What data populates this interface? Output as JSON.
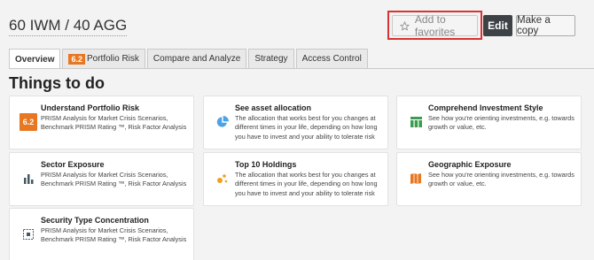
{
  "header": {
    "title": "60 IWM / 40 AGG",
    "favorites_label": "Add to favorites",
    "edit_label": "Edit",
    "copy_label": "Make a copy"
  },
  "tabs": [
    {
      "label": "Overview",
      "badge": ""
    },
    {
      "label": "Portfolio Risk",
      "badge": "6.2"
    },
    {
      "label": "Compare and Analyze",
      "badge": ""
    },
    {
      "label": "Strategy",
      "badge": ""
    },
    {
      "label": "Access Control",
      "badge": ""
    }
  ],
  "section_title": "Things to do",
  "cards": [
    {
      "title": "Understand Portfolio Risk",
      "desc": "PRISM Analysis for Market Crisis Scenarios, Benchmark PRISM Rating ™, Risk Factor Analysis",
      "icon": "prism-rating-badge-icon",
      "badge": "6.2"
    },
    {
      "title": "See asset allocation",
      "desc": "The allocation that works best for you changes at different times in your life, depending on how long you have to invest and your ability to tolerate risk",
      "icon": "pie-chart-icon"
    },
    {
      "title": "Comprehend Investment Style",
      "desc": "See how you're orienting investments, e.g. towards growth or value, etc.",
      "icon": "style-grid-icon"
    },
    {
      "title": "Sector Exposure",
      "desc": "PRISM Analysis for Market Crisis Scenarios, Benchmark PRISM Rating ™, Risk Factor Analysis",
      "icon": "bar-chart-icon"
    },
    {
      "title": "Top 10 Holdings",
      "desc": "The allocation that works best for you changes at different times in your life, depending on how long you have to invest and your ability to tolerate risk",
      "icon": "holdings-dots-icon"
    },
    {
      "title": "Geographic Exposure",
      "desc": "See how you're orienting investments, e.g. towards growth or value, etc.",
      "icon": "map-icon"
    },
    {
      "title": "Security Type Concentration",
      "desc": "PRISM Analysis for Market Crisis Scenarios, Benchmark PRISM Rating ™, Risk Factor Analysis",
      "icon": "concentration-icon"
    }
  ],
  "colors": {
    "accent": "#e87722",
    "blue_icon": "#4da3e8",
    "green_icon": "#3d9b52",
    "dark_icon": "#455a64",
    "highlight": "#d83232"
  }
}
